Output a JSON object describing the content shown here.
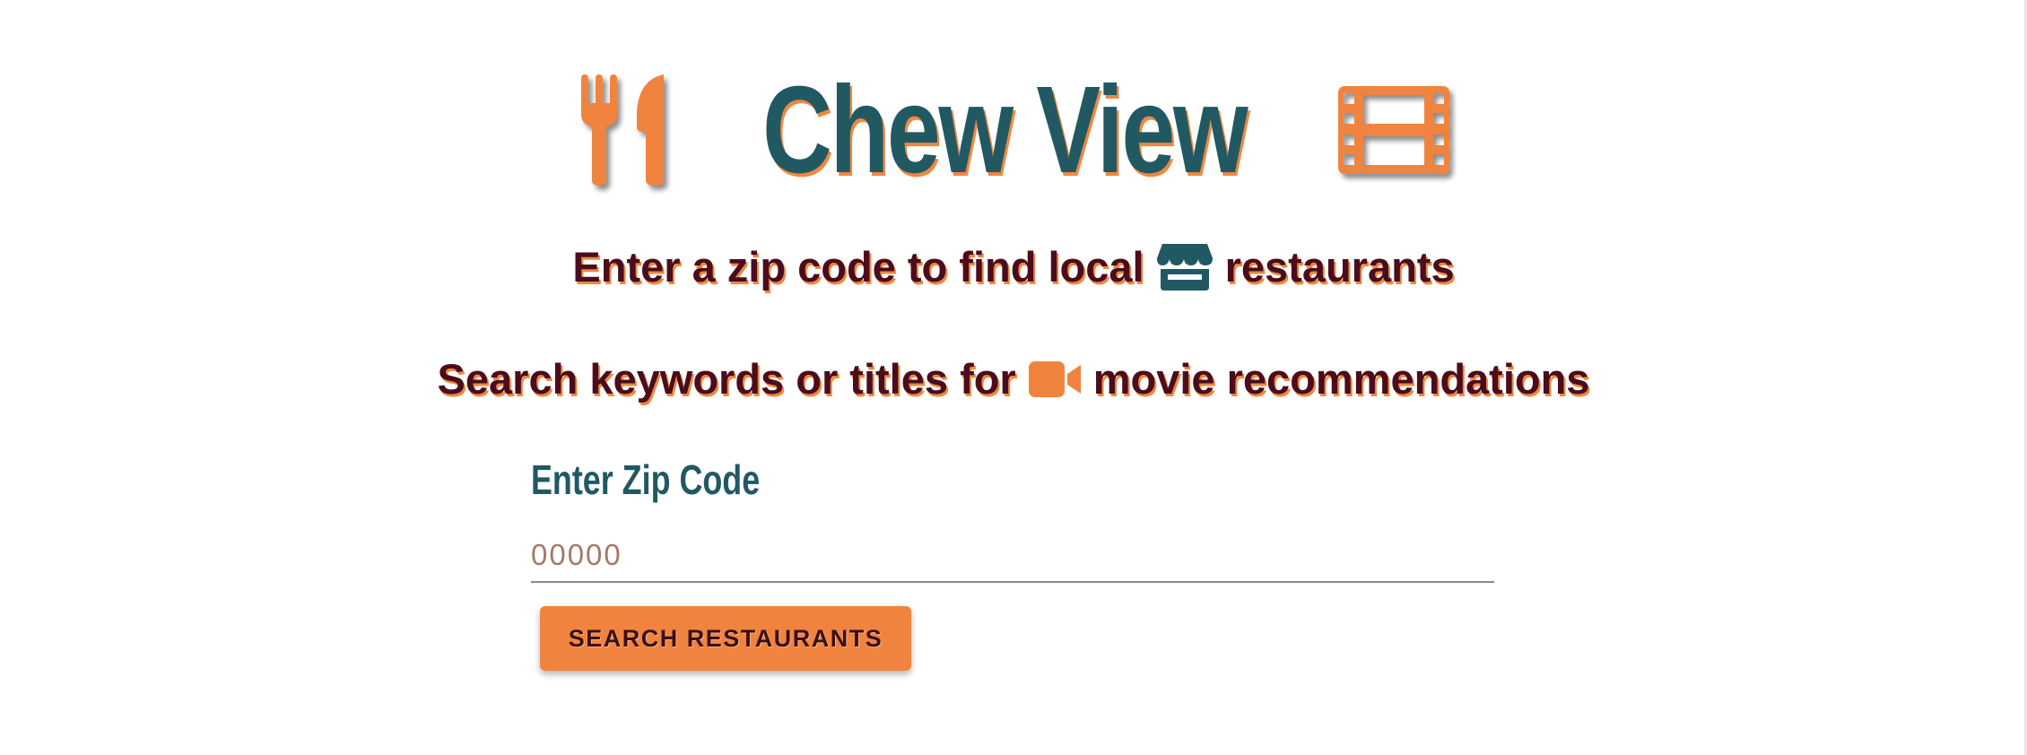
{
  "app": {
    "title": "Chew View"
  },
  "header": {
    "left_icon": "fork-knife-icon",
    "right_icon": "film-strip-icon"
  },
  "intro": {
    "restaurants_line_before": "Enter a zip code to find local",
    "restaurants_icon": "store-icon",
    "restaurants_line_after": "restaurants",
    "movies_line_before": "Search keywords or titles for",
    "movies_icon": "video-camera-icon",
    "movies_line_after": "movie recommendations"
  },
  "form": {
    "zip_label": "Enter Zip Code",
    "zip_placeholder": "00000",
    "zip_value": "",
    "search_button_label": "SEARCH RESTAURANTS"
  },
  "colors": {
    "brand_teal": "#215963",
    "accent_orange": "#f0843f",
    "text_dark_maroon": "#4a0d1d",
    "background": "#ffffff"
  }
}
